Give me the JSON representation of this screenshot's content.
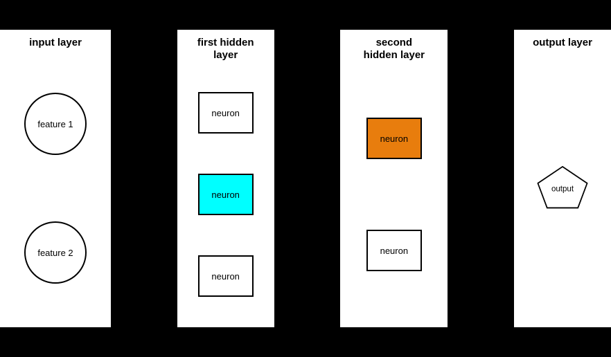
{
  "diagram": {
    "background": "#000000",
    "layers": [
      {
        "id": "input",
        "title": "input layer",
        "nodes": [
          "feature 1",
          "feature 2"
        ]
      },
      {
        "id": "first_hidden",
        "title": "first hidden\nlayer",
        "nodes": [
          "neuron",
          "neuron",
          "neuron"
        ]
      },
      {
        "id": "second_hidden",
        "title": "second\nhidden layer",
        "nodes": [
          "neuron",
          "neuron"
        ]
      },
      {
        "id": "output",
        "title": "output layer",
        "nodes": [
          "output"
        ]
      }
    ],
    "colors": {
      "background": "#000",
      "panel": "#fff",
      "default_node": "#fff",
      "cyan_node": "#00FFFF",
      "orange_node": "#E87D0D",
      "dashed_cyan": "#00D4E8",
      "dotted_orange": "#E87D0D"
    }
  }
}
